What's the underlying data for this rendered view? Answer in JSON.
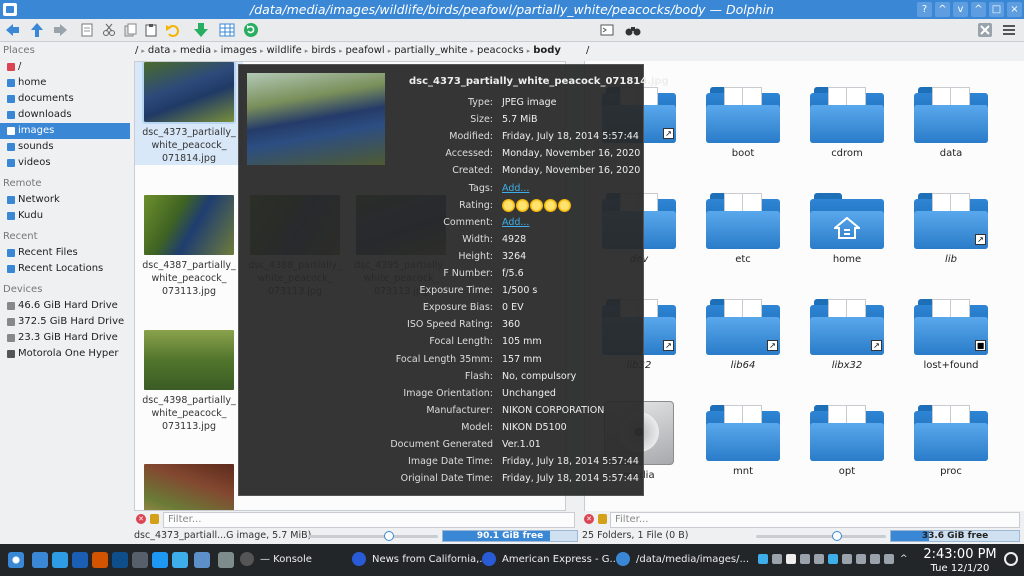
{
  "window": {
    "title": "/data/media/images/wildlife/birds/peafowl/partially_white/peacocks/body — Dolphin",
    "buttons": [
      "?",
      "^",
      "v",
      "^",
      "□",
      "×"
    ]
  },
  "places": {
    "sections": [
      {
        "title": "Places",
        "items": [
          {
            "label": "/",
            "color": "#da4453"
          },
          {
            "label": "home",
            "color": "#3a87d6"
          },
          {
            "label": "documents",
            "color": "#3a87d6"
          },
          {
            "label": "downloads",
            "color": "#3a87d6"
          },
          {
            "label": "images",
            "color": "#ffffff",
            "active": true
          },
          {
            "label": "sounds",
            "color": "#3a87d6"
          },
          {
            "label": "videos",
            "color": "#3a87d6"
          }
        ]
      },
      {
        "title": "Remote",
        "items": [
          {
            "label": "Network",
            "color": "#3a87d6"
          },
          {
            "label": "Kudu",
            "color": "#3a87d6"
          }
        ]
      },
      {
        "title": "Recent",
        "items": [
          {
            "label": "Recent Files",
            "color": "#3a87d6"
          },
          {
            "label": "Recent Locations",
            "color": "#3a87d6"
          }
        ]
      },
      {
        "title": "Devices",
        "items": [
          {
            "label": "46.6 GiB Hard Drive",
            "color": "#888888"
          },
          {
            "label": "372.5 GiB Hard Drive",
            "color": "#888888"
          },
          {
            "label": "23.3 GiB Hard Drive",
            "color": "#888888"
          },
          {
            "label": "Motorola One Hyper",
            "color": "#555555"
          }
        ]
      }
    ]
  },
  "breadcrumb": {
    "left": [
      "/",
      "data",
      "media",
      "images",
      "wildlife",
      "birds",
      "peafowl",
      "partially_white",
      "peacocks",
      "body"
    ],
    "right": "/"
  },
  "left_files": [
    {
      "label": "dsc_4373_partially_\nwhite_peacock_\n071814.jpg",
      "selected": true
    },
    {
      "label": "dsc_4387_partially_\nwhite_peacock_\n073113.jpg"
    },
    {
      "label": "dsc_4398_partially_\nwhite_peacock_\n073113.jpg"
    },
    {
      "label": ""
    }
  ],
  "right_folders": [
    {
      "label": "",
      "badge": "link"
    },
    {
      "label": "boot"
    },
    {
      "label": "cdrom"
    },
    {
      "label": "data"
    },
    {
      "label": "dev",
      "italic": true
    },
    {
      "label": "etc"
    },
    {
      "label": "home",
      "home": true
    },
    {
      "label": "lib",
      "italic": true,
      "badge": "link"
    },
    {
      "label": "lib32",
      "italic": true,
      "badge": "link"
    },
    {
      "label": "lib64",
      "italic": true,
      "badge": "link"
    },
    {
      "label": "libx32",
      "italic": true,
      "badge": "link"
    },
    {
      "label": "lost+found",
      "badge": "lock"
    },
    {
      "label": "media",
      "hdd": true
    },
    {
      "label": "mnt"
    },
    {
      "label": "opt"
    },
    {
      "label": "proc"
    }
  ],
  "tooltip": {
    "title": "dsc_4373_partially_white_peacock_071814.jpg",
    "rows": [
      {
        "k": "Type:",
        "v": "JPEG image"
      },
      {
        "k": "Size:",
        "v": "5.7 MiB"
      },
      {
        "k": "Modified:",
        "v": "Friday, July 18, 2014 5:57:44"
      },
      {
        "k": "Accessed:",
        "v": "Monday, November 16, 2020"
      },
      {
        "k": "Created:",
        "v": "Monday, November 16, 2020"
      },
      {
        "k": "Tags:",
        "v": "Add...",
        "link": true
      },
      {
        "k": "Rating:",
        "stars": 5
      },
      {
        "k": "Comment:",
        "v": "Add...",
        "link": true
      },
      {
        "k": "Width:",
        "v": "4928"
      },
      {
        "k": "Height:",
        "v": "3264"
      },
      {
        "k": "F Number:",
        "v": "f/5.6"
      },
      {
        "k": "Exposure Time:",
        "v": "1/500 s"
      },
      {
        "k": "Exposure Bias:",
        "v": "0 EV"
      },
      {
        "k": "ISO Speed Rating:",
        "v": "360"
      },
      {
        "k": "Focal Length:",
        "v": "105 mm"
      },
      {
        "k": "Focal Length 35mm:",
        "v": "157 mm"
      },
      {
        "k": "Flash:",
        "v": "No, compulsory"
      },
      {
        "k": "Image Orientation:",
        "v": "Unchanged"
      },
      {
        "k": "Manufacturer:",
        "v": "NIKON CORPORATION"
      },
      {
        "k": "Model:",
        "v": "NIKON D5100"
      },
      {
        "k": "Document Generated",
        "v": "Ver.1.01"
      },
      {
        "k": "Image Date Time:",
        "v": "Friday, July 18, 2014 5:57:44"
      },
      {
        "k": "Original Date Time:",
        "v": "Friday, July 18, 2014 5:57:44"
      }
    ]
  },
  "filter": {
    "placeholder_left": "Filter...",
    "placeholder_right": "Filter..."
  },
  "status": {
    "left_text": "dsc_4373_partiall...G image, 5.7 MiB)",
    "left_free": "90.1 GiB free",
    "left_free_fraction": 0.8,
    "right_text": "25 Folders, 1 File (0 B)",
    "right_free": "33.6 GiB free",
    "right_free_fraction": 0.3
  },
  "taskbar": {
    "tasks": [
      {
        "label": "— Konsole",
        "color": "#555555"
      },
      {
        "label": "News from California,...",
        "color": "#2a5bd7"
      },
      {
        "label": "American Express - G...",
        "color": "#2a5bd7"
      },
      {
        "label": "/data/media/images/...",
        "color": "#3a87d6"
      }
    ],
    "time": "2:43:00 PM",
    "date": "Tue 12/1/20"
  }
}
